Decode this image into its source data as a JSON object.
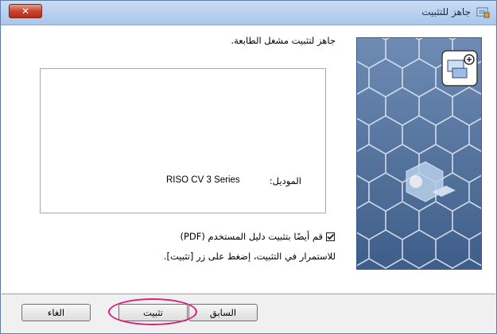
{
  "window": {
    "title": "جاهز للتثبيت",
    "close_icon": "close-icon",
    "app_icon": "installer-icon"
  },
  "main": {
    "header_text": "جاهز لتثبيت مشغل الطابعة.",
    "model_label": "الموديل:",
    "model_value": "RISO CV 3 Series",
    "checkbox_label": "قم أيضًا بتثبيت دليل المستخدم (PDF)",
    "checkbox_checked": true,
    "continue_text": "للاستمرار في التثبيت، إضغط على زر [تثبيت]."
  },
  "buttons": {
    "back": "السابق",
    "install": "تثبيت",
    "cancel": "الغاء"
  },
  "colors": {
    "highlight": "#d8207a",
    "close": "#c8452e",
    "image_bg": "#4f6f99"
  }
}
